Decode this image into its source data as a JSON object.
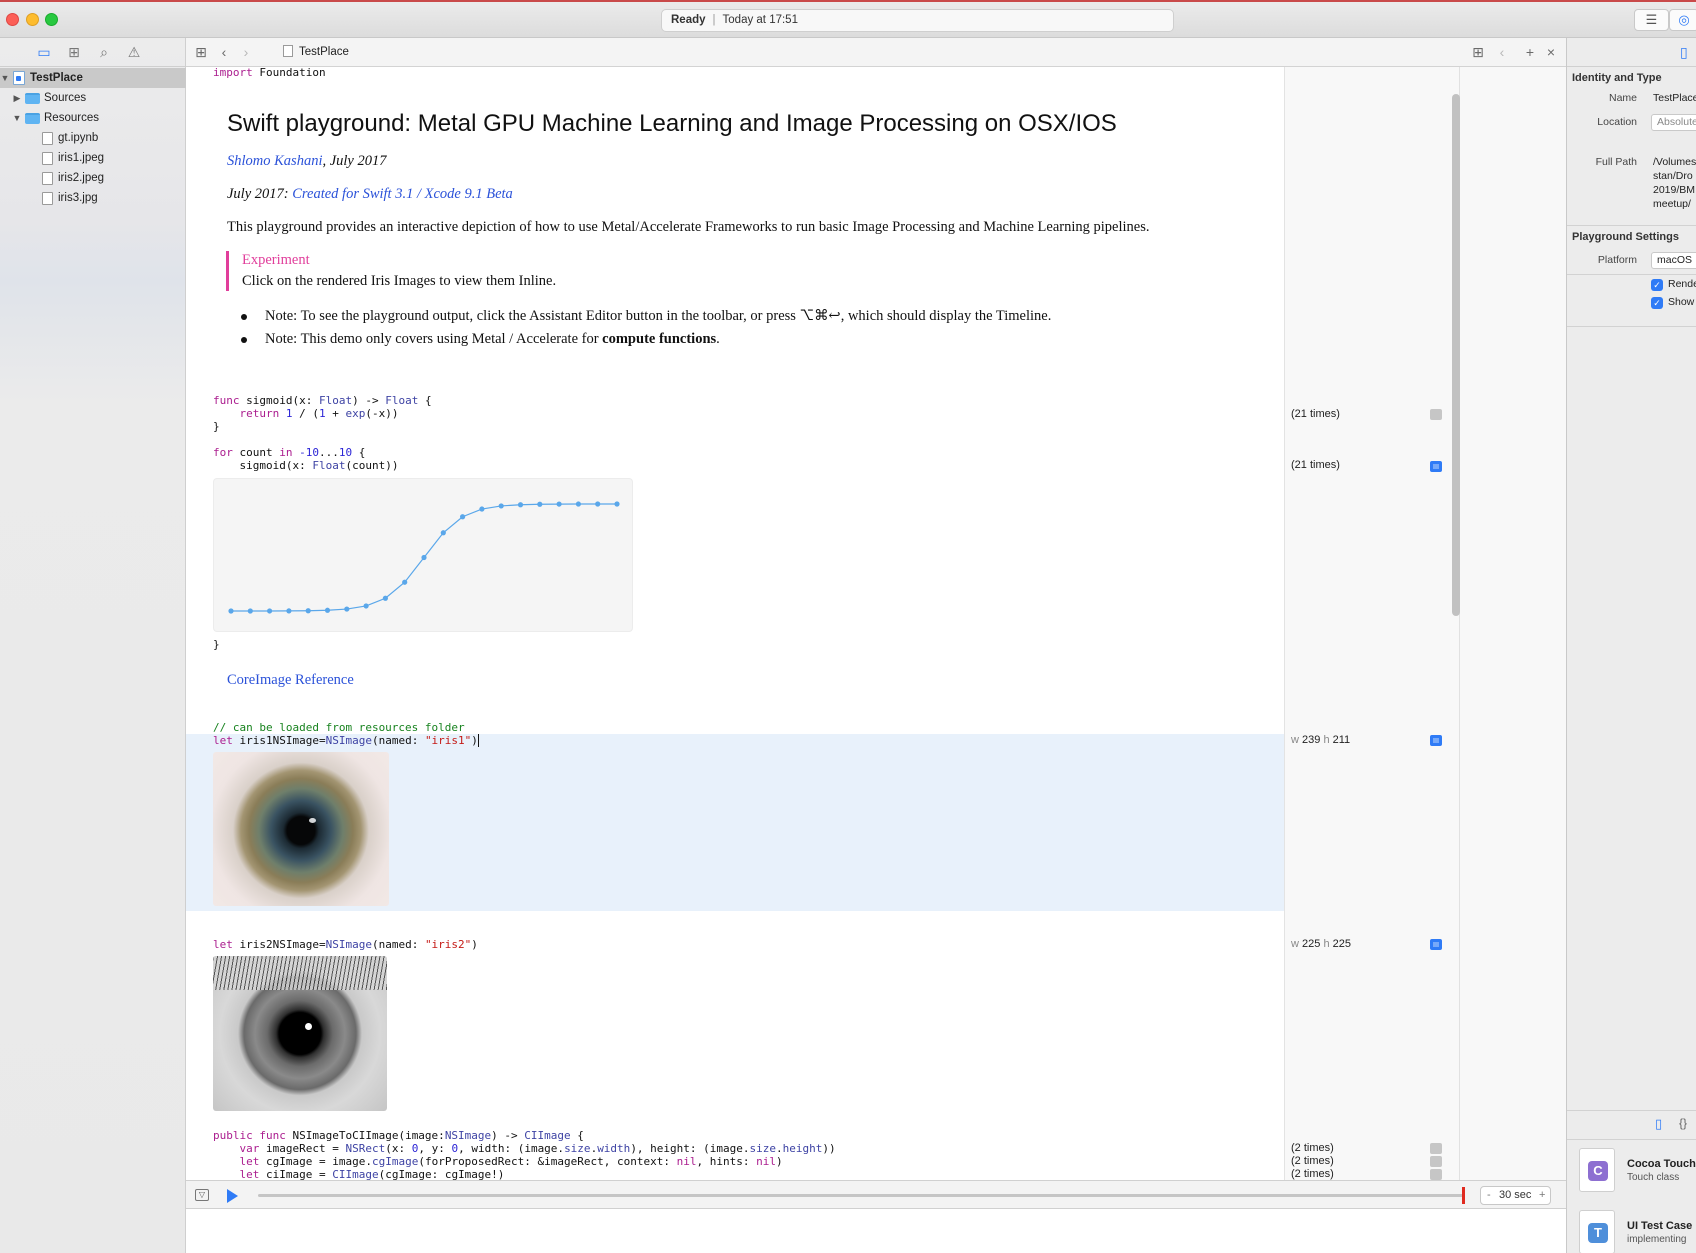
{
  "window": {
    "status": {
      "state": "Ready",
      "time": "Today at 17:51"
    }
  },
  "navigator": {
    "project": "TestPlace",
    "items": [
      {
        "label": "Sources",
        "kind": "folder"
      },
      {
        "label": "Resources",
        "kind": "folder"
      },
      {
        "label": "gt.ipynb",
        "kind": "file"
      },
      {
        "label": "iris1.jpeg",
        "kind": "file"
      },
      {
        "label": "iris2.jpeg",
        "kind": "file"
      },
      {
        "label": "iris3.jpg",
        "kind": "file"
      }
    ]
  },
  "jumpbar": {
    "file": "TestPlace"
  },
  "editor": {
    "import_line": {
      "kw": "import",
      "name": "Foundation"
    },
    "md": {
      "title": "Swift playground: Metal GPU Machine Learning and Image Processing on OSX/IOS",
      "author_link": "Shlomo Kashani",
      "author_date": ", July 2017",
      "release_prefix": "July 2017: ",
      "release_link": "Created for Swift 3.1 / Xcode 9.1 Beta",
      "intro": "This playground provides an interactive depiction of how to use Metal/Accelerate Frameworks to run basic Image Processing and Machine Learning pipelines.",
      "experiment_label": "Experiment",
      "experiment_text": "Click on the rendered Iris Images to view them Inline.",
      "note1": "Note: To see the playground output, click the Assistant Editor button in the toolbar, or press ⌥⌘↩, which should display the Timeline.",
      "note2_prefix": "Note: This demo only covers using Metal / Accelerate for ",
      "note2_bold": "compute functions",
      "note2_suffix": ".",
      "coreimage_link": "CoreImage Reference"
    },
    "sigmoid_chart": {
      "type": "line",
      "x": [
        -10,
        -9,
        -8,
        -7,
        -6,
        -5,
        -4,
        -3,
        -2,
        -1,
        0,
        1,
        2,
        3,
        4,
        5,
        6,
        7,
        8,
        9,
        10
      ],
      "values": [
        5e-05,
        0.0001,
        0.0003,
        0.0009,
        0.0025,
        0.0067,
        0.018,
        0.047,
        0.119,
        0.269,
        0.5,
        0.731,
        0.881,
        0.953,
        0.982,
        0.993,
        0.9975,
        0.9991,
        0.9997,
        0.9999,
        0.99995
      ],
      "ylim": [
        0,
        1
      ],
      "line_color": "#5aa7ea"
    },
    "results": {
      "r1": "(21 times)",
      "r2": "(21 times)",
      "r3_w": "239",
      "r3_h": "211",
      "r4_w": "225",
      "r4_h": "225",
      "r5": "(2 times)",
      "r6": "(2 times)",
      "r7": "(2 times)",
      "w_label": "w",
      "h_label": "h"
    }
  },
  "debug": {
    "timeout": "30 sec",
    "minus": "-",
    "plus": "+"
  },
  "inspector": {
    "identity_title": "Identity and Type",
    "name_label": "Name",
    "name_value": "TestPlace",
    "location_label": "Location",
    "location_value": "Absolute",
    "fullpath_label": "Full Path",
    "fullpath_lines": [
      "/Volumes",
      "stan/Dro",
      "2019/BM",
      "meetup/"
    ],
    "playground_title": "Playground Settings",
    "platform_label": "Platform",
    "platform_value": "macOS",
    "check1": "Render",
    "check2": "Show",
    "lib1_title": "Cocoa Touch",
    "lib1_sub": "Touch class",
    "lib2_title": "UI Test Case",
    "lib2_sub": "implementing"
  },
  "colors": {
    "accent": "#2f7bf6",
    "link": "#2b52d9",
    "experiment": "#e13e9b"
  }
}
